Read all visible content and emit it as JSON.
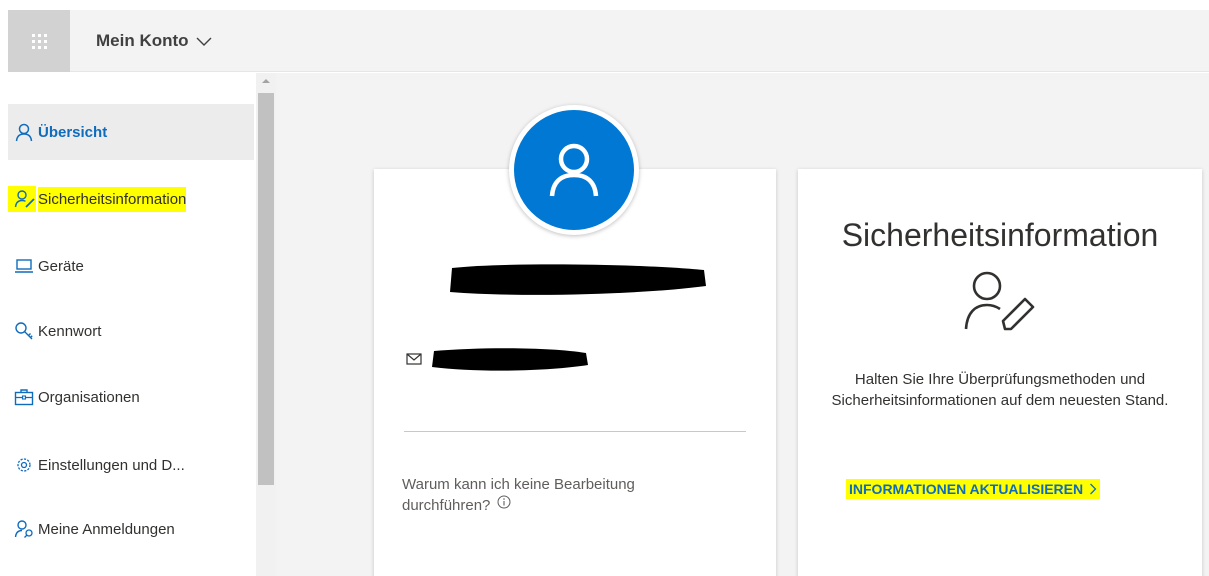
{
  "header": {
    "app_title": "Mein Konto",
    "waffle_icon": "app-launcher-icon"
  },
  "sidebar": {
    "items": [
      {
        "label": "Übersicht",
        "icon": "person-icon",
        "active": true
      },
      {
        "label": "Sicherheitsinformation",
        "icon": "person-edit-icon",
        "highlighted": true
      },
      {
        "label": "Geräte",
        "icon": "laptop-icon"
      },
      {
        "label": "Kennwort",
        "icon": "key-icon"
      },
      {
        "label": "Organisationen",
        "icon": "briefcase-icon"
      },
      {
        "label": "Einstellungen und D...",
        "icon": "gear-icon"
      },
      {
        "label": "Meine Anmeldungen",
        "icon": "person-key-icon"
      }
    ]
  },
  "profile_card": {
    "why_text": "Warum kann ich keine Bearbeitung durchführen?"
  },
  "security_card": {
    "title": "Sicherheitsinformation",
    "description": "Halten Sie Ihre Überprüfungsmethoden und Sicherheitsinformationen auf dem neuesten Stand.",
    "link_label": "INFORMATIONEN AKTUALISIEREN"
  },
  "colors": {
    "accent": "#0f6cbd",
    "avatar": "#0078d4",
    "highlight": "#ffff00"
  }
}
